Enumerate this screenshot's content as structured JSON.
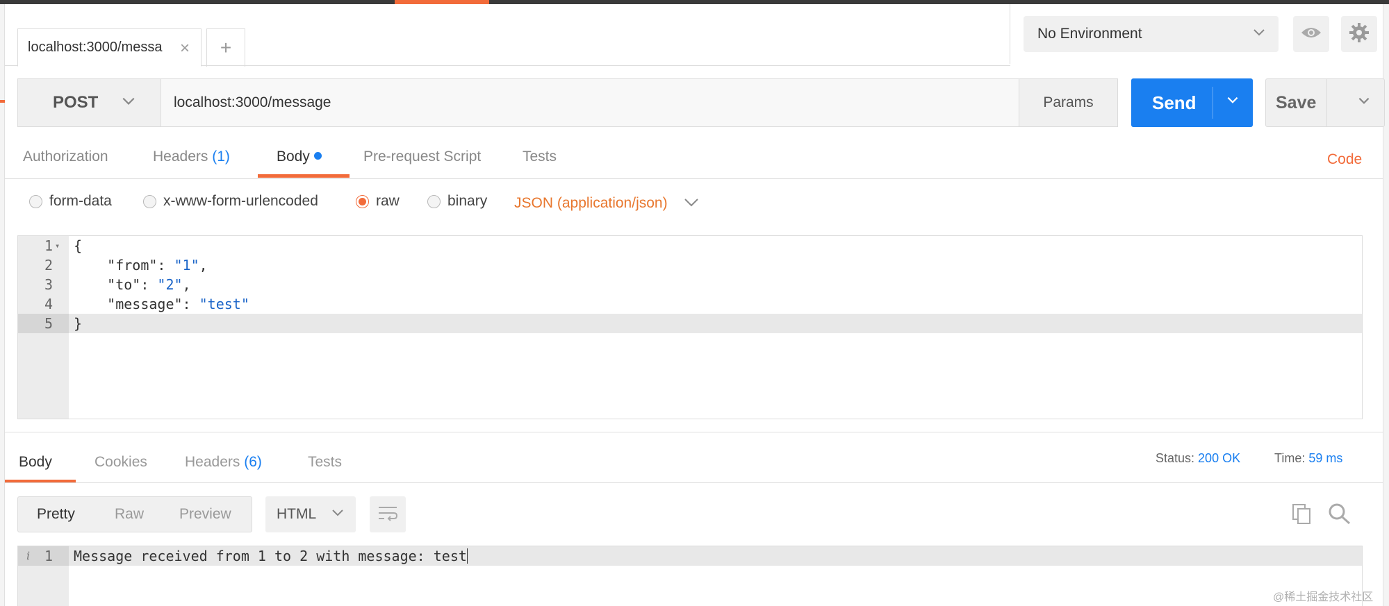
{
  "tabs": {
    "active_tab_label": "localhost:3000/messa",
    "close_glyph": "×",
    "new_tab_glyph": "+"
  },
  "environment": {
    "selected": "No Environment"
  },
  "request": {
    "method": "POST",
    "url": "localhost:3000/message",
    "params_label": "Params",
    "send_label": "Send",
    "save_label": "Save"
  },
  "request_tabs": {
    "authorization": "Authorization",
    "headers": "Headers",
    "headers_count": "(1)",
    "body": "Body",
    "prerequest": "Pre-request Script",
    "tests": "Tests",
    "code_link": "Code"
  },
  "body_types": {
    "form_data": "form-data",
    "urlencoded": "x-www-form-urlencoded",
    "raw": "raw",
    "binary": "binary",
    "content_type": "JSON (application/json)"
  },
  "editor": {
    "lines": [
      {
        "n": "1",
        "text": "{"
      },
      {
        "n": "2",
        "key": "    \"from\": ",
        "val": "\"1\"",
        "tail": ","
      },
      {
        "n": "3",
        "key": "    \"to\": ",
        "val": "\"2\"",
        "tail": ","
      },
      {
        "n": "4",
        "key": "    \"message\": ",
        "val": "\"test\"",
        "tail": ""
      },
      {
        "n": "5",
        "text": "}"
      }
    ]
  },
  "response_tabs": {
    "body": "Body",
    "cookies": "Cookies",
    "headers": "Headers",
    "headers_count": "(6)",
    "tests": "Tests"
  },
  "response_meta": {
    "status_label": "Status:",
    "status_value": "200 OK",
    "time_label": "Time:",
    "time_value": "59 ms"
  },
  "response_view": {
    "pretty": "Pretty",
    "raw": "Raw",
    "preview": "Preview",
    "format": "HTML"
  },
  "response_body": {
    "line_number": "1",
    "info_glyph": "i",
    "text": "Message received from 1 to 2 with message: test"
  },
  "watermark": "@稀土掘金技术社区",
  "colors": {
    "accent_orange": "#f26b3a",
    "send_blue": "#1a7ff0",
    "link_blue": "#1a7ff0"
  }
}
